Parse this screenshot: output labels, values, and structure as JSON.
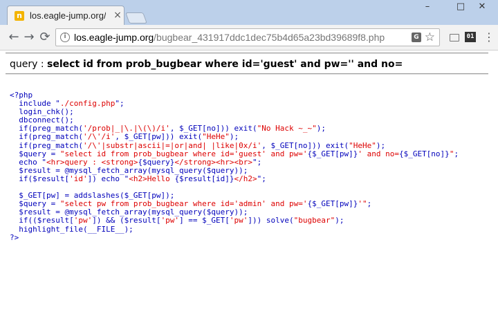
{
  "window": {
    "tab_title": "los.eagle-jump.org/bugb",
    "tab_close": "×",
    "favicon_glyph": "n",
    "min_glyph": "–",
    "max_glyph": "□",
    "close_glyph": "✕",
    "accent": "#bcd0ea"
  },
  "toolbar": {
    "back_glyph": "←",
    "forward_glyph": "→",
    "reload_glyph": "⟳",
    "info_glyph": "i",
    "url_host": "los.eagle-jump.org",
    "url_path": "/bugbear_431917ddc1dec75b4d65a23bd39689f8.php",
    "translate_glyph": "G",
    "star_glyph": "☆",
    "ext_label": "01",
    "menu_glyph": "⋮"
  },
  "page": {
    "query_label": "query : ",
    "query_value": "select id from prob_bugbear where id='guest' and pw='' and no="
  },
  "source": {
    "lines": [
      [
        {
          "t": "&lt;?php",
          "c": "kw"
        }
      ],
      [
        {
          "t": "  include \"",
          "c": "kw"
        },
        {
          "t": "./config.php",
          "c": "st"
        },
        {
          "t": "\";",
          "c": "kw"
        }
      ],
      [
        {
          "t": "  login_chk();",
          "c": "kw"
        }
      ],
      [
        {
          "t": "  dbconnect();",
          "c": "kw"
        }
      ],
      [
        {
          "t": "  if(preg_match(",
          "c": "kw"
        },
        {
          "t": "'/prob|_|\\.|\\(\\)/i'",
          "c": "st"
        },
        {
          "t": ", $_GET[no])) exit(",
          "c": "kw"
        },
        {
          "t": "\"No Hack ~_~\"",
          "c": "st"
        },
        {
          "t": ");",
          "c": "kw"
        }
      ],
      [
        {
          "t": "  if(preg_match(",
          "c": "kw"
        },
        {
          "t": "'/\\'/i'",
          "c": "st"
        },
        {
          "t": ", $_GET[pw])) exit(",
          "c": "kw"
        },
        {
          "t": "\"HeHe\"",
          "c": "st"
        },
        {
          "t": ");",
          "c": "kw"
        }
      ],
      [
        {
          "t": "  if(preg_match(",
          "c": "kw"
        },
        {
          "t": "'/\\'|substr|ascii|=|or|and| |like|0x/i'",
          "c": "st"
        },
        {
          "t": ", $_GET[no])) exit(",
          "c": "kw"
        },
        {
          "t": "\"HeHe\"",
          "c": "st"
        },
        {
          "t": ");",
          "c": "kw"
        }
      ],
      [
        {
          "t": "  $query = ",
          "c": "kw"
        },
        {
          "t": "\"select id from prob_bugbear where id='guest' and pw='",
          "c": "st"
        },
        {
          "t": "{$_GET[pw]}",
          "c": "ph"
        },
        {
          "t": "' and no=",
          "c": "st"
        },
        {
          "t": "{$_GET[no]}",
          "c": "ph"
        },
        {
          "t": "\"",
          "c": "st"
        },
        {
          "t": ";",
          "c": "kw"
        }
      ],
      [
        {
          "t": "  echo \"",
          "c": "kw"
        },
        {
          "t": "&lt;hr&gt;query : &lt;strong&gt;",
          "c": "st"
        },
        {
          "t": "{$query}",
          "c": "ph"
        },
        {
          "t": "&lt;/strong&gt;&lt;hr&gt;&lt;br&gt;",
          "c": "st"
        },
        {
          "t": "\";",
          "c": "kw"
        }
      ],
      [
        {
          "t": "  $result = @mysql_fetch_array(mysql_query($query));",
          "c": "kw"
        }
      ],
      [
        {
          "t": "  if($result[",
          "c": "kw"
        },
        {
          "t": "'id'",
          "c": "st"
        },
        {
          "t": "]) echo \"",
          "c": "kw"
        },
        {
          "t": "&lt;h2&gt;Hello ",
          "c": "st"
        },
        {
          "t": "{$result[id]}",
          "c": "ph"
        },
        {
          "t": "&lt;/h2&gt;",
          "c": "st"
        },
        {
          "t": "\";",
          "c": "kw"
        }
      ],
      [
        {
          "t": " ",
          "c": "kw"
        }
      ],
      [
        {
          "t": "  $_GET[pw] = addslashes($_GET[pw]);",
          "c": "kw"
        }
      ],
      [
        {
          "t": "  $query = ",
          "c": "kw"
        },
        {
          "t": "\"select pw from prob_bugbear where id='admin' and pw='",
          "c": "st"
        },
        {
          "t": "{$_GET[pw]}",
          "c": "ph"
        },
        {
          "t": "'\"",
          "c": "st"
        },
        {
          "t": ";",
          "c": "kw"
        }
      ],
      [
        {
          "t": "  $result = @mysql_fetch_array(mysql_query($query));",
          "c": "kw"
        }
      ],
      [
        {
          "t": "  if(($result[",
          "c": "kw"
        },
        {
          "t": "'pw'",
          "c": "st"
        },
        {
          "t": "]) &amp;&amp; ($result[",
          "c": "kw"
        },
        {
          "t": "'pw'",
          "c": "st"
        },
        {
          "t": "] == $_GET[",
          "c": "kw"
        },
        {
          "t": "'pw'",
          "c": "st"
        },
        {
          "t": "])) solve(",
          "c": "kw"
        },
        {
          "t": "\"bugbear\"",
          "c": "st"
        },
        {
          "t": ");",
          "c": "kw"
        }
      ],
      [
        {
          "t": "  highlight_file(__FILE__);",
          "c": "kw"
        }
      ],
      [
        {
          "t": "?&gt;",
          "c": "kw"
        }
      ]
    ]
  }
}
